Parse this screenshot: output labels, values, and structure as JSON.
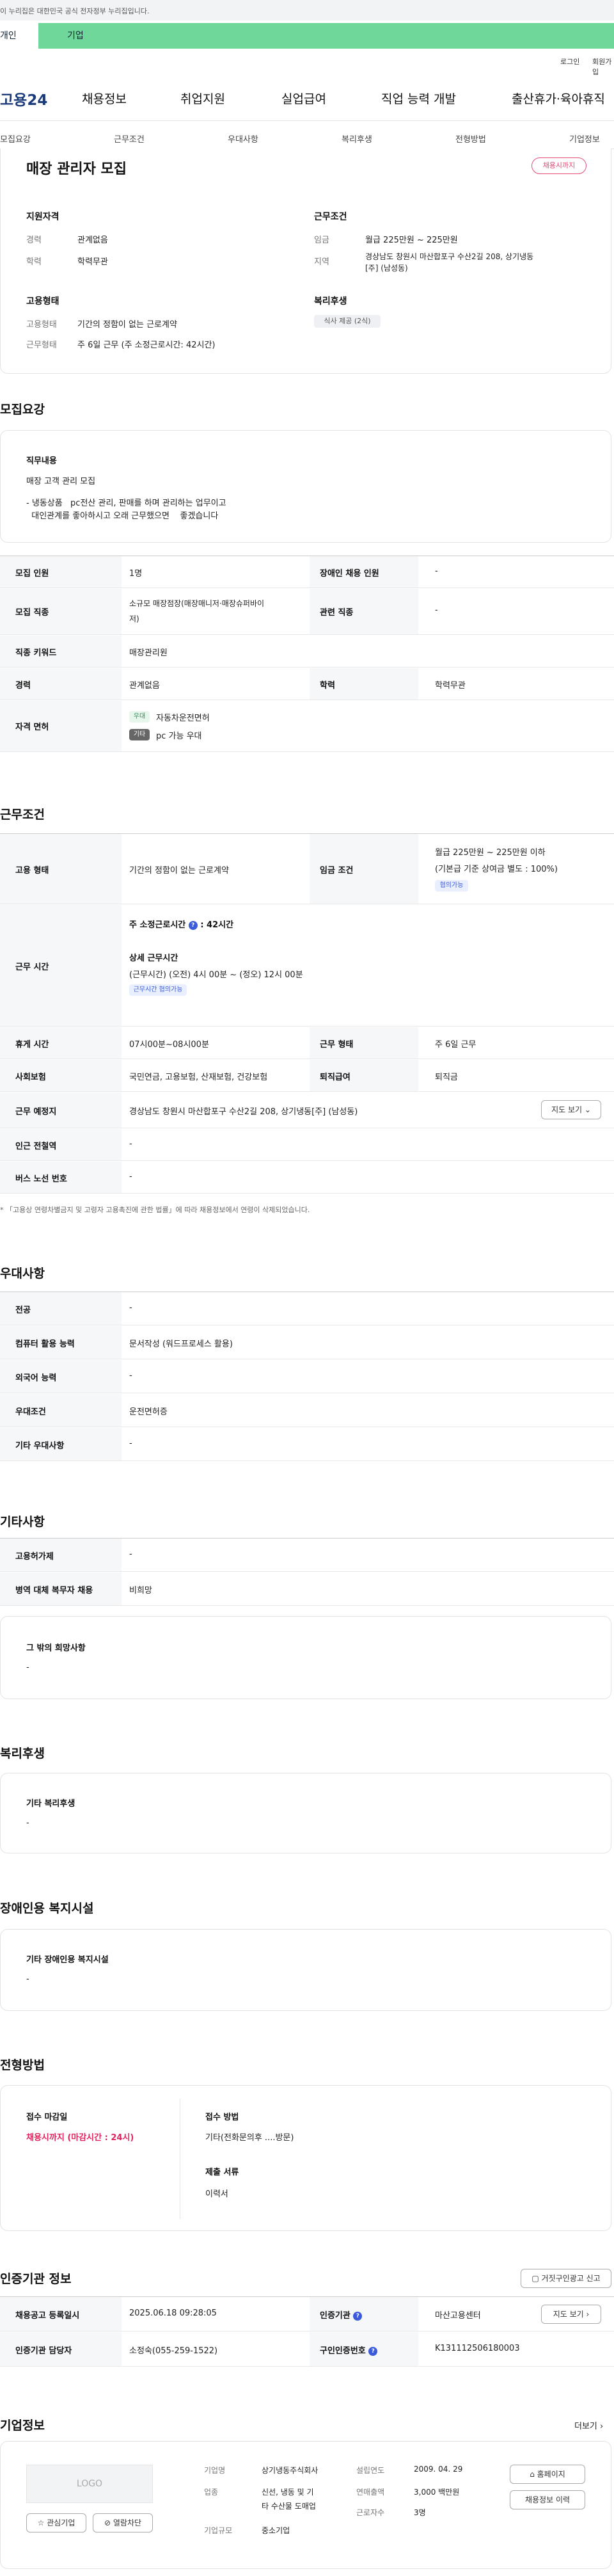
{
  "gov_banner": "이 누리집은 대한민국 공식 전자정부 누리집입니다.",
  "service_tabs": [
    "개인",
    "기업"
  ],
  "util_links": [
    "로그인",
    "회원가입"
  ],
  "logo": "고용24",
  "nav_items": [
    "채용정보",
    "취업지원",
    "실업급여",
    "직업 능력 개발",
    "출산휴가·육아휴직"
  ],
  "sub_tabs": [
    "모집요강",
    "근무조건",
    "우대사항",
    "복리후생",
    "전형방법",
    "기업정보"
  ],
  "job": {
    "title": "매장 관리자 모집",
    "status_badge": "채용시까지",
    "qual_title": "지원자격",
    "career_label": "경력",
    "career_value": "관계없음",
    "edu_label": "학력",
    "edu_value": "학력무관",
    "emp_title": "고용형태",
    "emp_type_label": "고용형태",
    "emp_type_value": "기간의 정함이 없는 근로계약",
    "work_type_label": "근무형태",
    "work_type_value": "주 6일 근무 (주 소정근로시간: 42시간)",
    "cond_title": "근무조건",
    "wage_label": "임금",
    "wage_value": "월급 225만원 ~ 225만원",
    "region_label": "지역",
    "region_value_1": "경상남도 창원시 마산합포구 수산2길 208, 상기냉동",
    "region_value_2": "[주] (남성동)",
    "welfare_title": "복리후생",
    "welfare_chip": "식사 제공 (2식)"
  },
  "sections": {
    "recruit": "모집요강",
    "conditions": "근무조건",
    "preference": "우대사항",
    "etc": "기타사항",
    "welfare": "복리후생",
    "facility": "장애인용 복지시설",
    "selection": "전형방법",
    "agency": "인증기관 정보",
    "company": "기업정보"
  },
  "duty": {
    "title": "직무내용",
    "line1": "매장  고객 관리 모집",
    "line2": "- 냉동상품   pc전산 관리, 판매를 하며 관리하는 업무이고",
    "line3": "  대인관계를 좋아하시고 오래 근무했으면    좋겠습니다"
  },
  "recruit_table": {
    "headcount_label": "모집 인원",
    "headcount_value": "1명",
    "disabled_label": "장애인 채용 인원",
    "disabled_value": "-",
    "job_label": "모집 직종",
    "job_value_1": "소규모 매장점장(매장매니저·매장슈퍼바이",
    "job_value_2": "저)",
    "related_label": "관련 직종",
    "related_value": "-",
    "keyword_label": "직종 키워드",
    "keyword_value": "매장관리원",
    "career_label": "경력",
    "career_value": "관계없음",
    "edu_label": "학력",
    "edu_value": "학력무관",
    "license_label": "자격 면허",
    "license_tag1": "우대",
    "license_value1": "자동차운전면허",
    "license_tag2": "기타",
    "license_value2": "pc 가능 우대"
  },
  "cond_table": {
    "emp_label": "고용 형태",
    "emp_value": "기간의 정함이 없는 근로계약",
    "wage_label": "임금 조건",
    "wage_value_1": "월급 225만원 ~ 225만원 이하",
    "wage_value_2": "(기본급 기준 상여금 별도 : 100%)",
    "wage_tag": "협의가능",
    "hours_label": "근무 시간",
    "hours_week": "주 소정근로시간",
    "hours_week_val": ": 42시간",
    "hours_detail_title": "상세 근무시간",
    "hours_detail": "(근무시간) (오전) 4시 00분 ~ (정오) 12시 00분",
    "hours_tag": "근무시간 협의가능",
    "break_label": "휴게 시간",
    "break_value": "07시00분~08시00분",
    "worktype_label": "근무 형태",
    "worktype_value": "주 6일 근무",
    "insurance_label": "사회보험",
    "insurance_value": "국민연금, 고용보험, 산재보험, 건강보험",
    "severance_label": "퇴직급여",
    "severance_value": "퇴직금",
    "place_label": "근무 예정지",
    "place_value": "경상남도 창원시 마산합포구 수산2길 208, 상기냉동[주] (남성동)",
    "map_btn": "지도 보기",
    "subway_label": "인근 전철역",
    "subway_value": "-",
    "bus_label": "버스 노선 번호",
    "bus_value": "-",
    "note": "* 「고용상 연령차별금지 및 고령자 고용촉진에 관한 법률」에 따라 채용정보에서 연령이 삭제되었습니다."
  },
  "pref_table": {
    "major_label": "전공",
    "major_value": "-",
    "computer_label": "컴퓨터 활용 능력",
    "computer_value": "문서작성 (워드프로세스 활용)",
    "lang_label": "외국어 능력",
    "lang_value": "-",
    "cond_label": "우대조건",
    "cond_value": "운전면허증",
    "other_label": "기타 우대사항",
    "other_value": "-"
  },
  "etc_table": {
    "visa_label": "고용허가제",
    "visa_value": "-",
    "military_label": "병역 대체 복무자 채용",
    "military_value": "비희망",
    "hope_title": "그 밖의 희망사항",
    "hope_value": "-"
  },
  "welfare_box": {
    "title": "기타 복리후생",
    "value": "-"
  },
  "facility_box": {
    "title": "기타 장애인용 복지시설",
    "value": "-"
  },
  "selection_box": {
    "deadline_title": "접수 마감일",
    "deadline_value": "채용시까지 (마감시간 : 24시)",
    "method_title": "접수 방법",
    "method_value": "기타(전화문의후 ....방문)",
    "docs_title": "제출 서류",
    "docs_value": "이력서"
  },
  "agency_table": {
    "report_btn": "거짓구인광고 신고",
    "date_label": "채용공고 등록일시",
    "date_value": "2025.06.18 09:28:05",
    "agency_label": "인증기관",
    "agency_value": "마산고용센터",
    "map_btn": "지도 보기",
    "contact_label": "인증기관 담당자",
    "contact_value": "소정숙(055-259-1522)",
    "authno_label": "구인인증번호",
    "authno_value": "K131112506180003"
  },
  "company": {
    "more": "더보기",
    "logo_text": "LOGO",
    "fav_btn": "관심기업",
    "block_btn": "열람차단",
    "name_label": "기업명",
    "name_value": "상기냉동주식회사",
    "industry_label": "업종",
    "industry_value_1": "신선, 냉동 및 기",
    "industry_value_2": "타 수산물 도매업",
    "size_label": "기업규모",
    "size_value": "중소기업",
    "founded_label": "설립연도",
    "founded_value": "2009. 04. 29",
    "sales_label": "연매출액",
    "sales_value": "3,000 백만원",
    "employees_label": "근로자수",
    "employees_value": "3명",
    "home_btn": "홈페이지",
    "history_btn": "채용정보 이력"
  }
}
